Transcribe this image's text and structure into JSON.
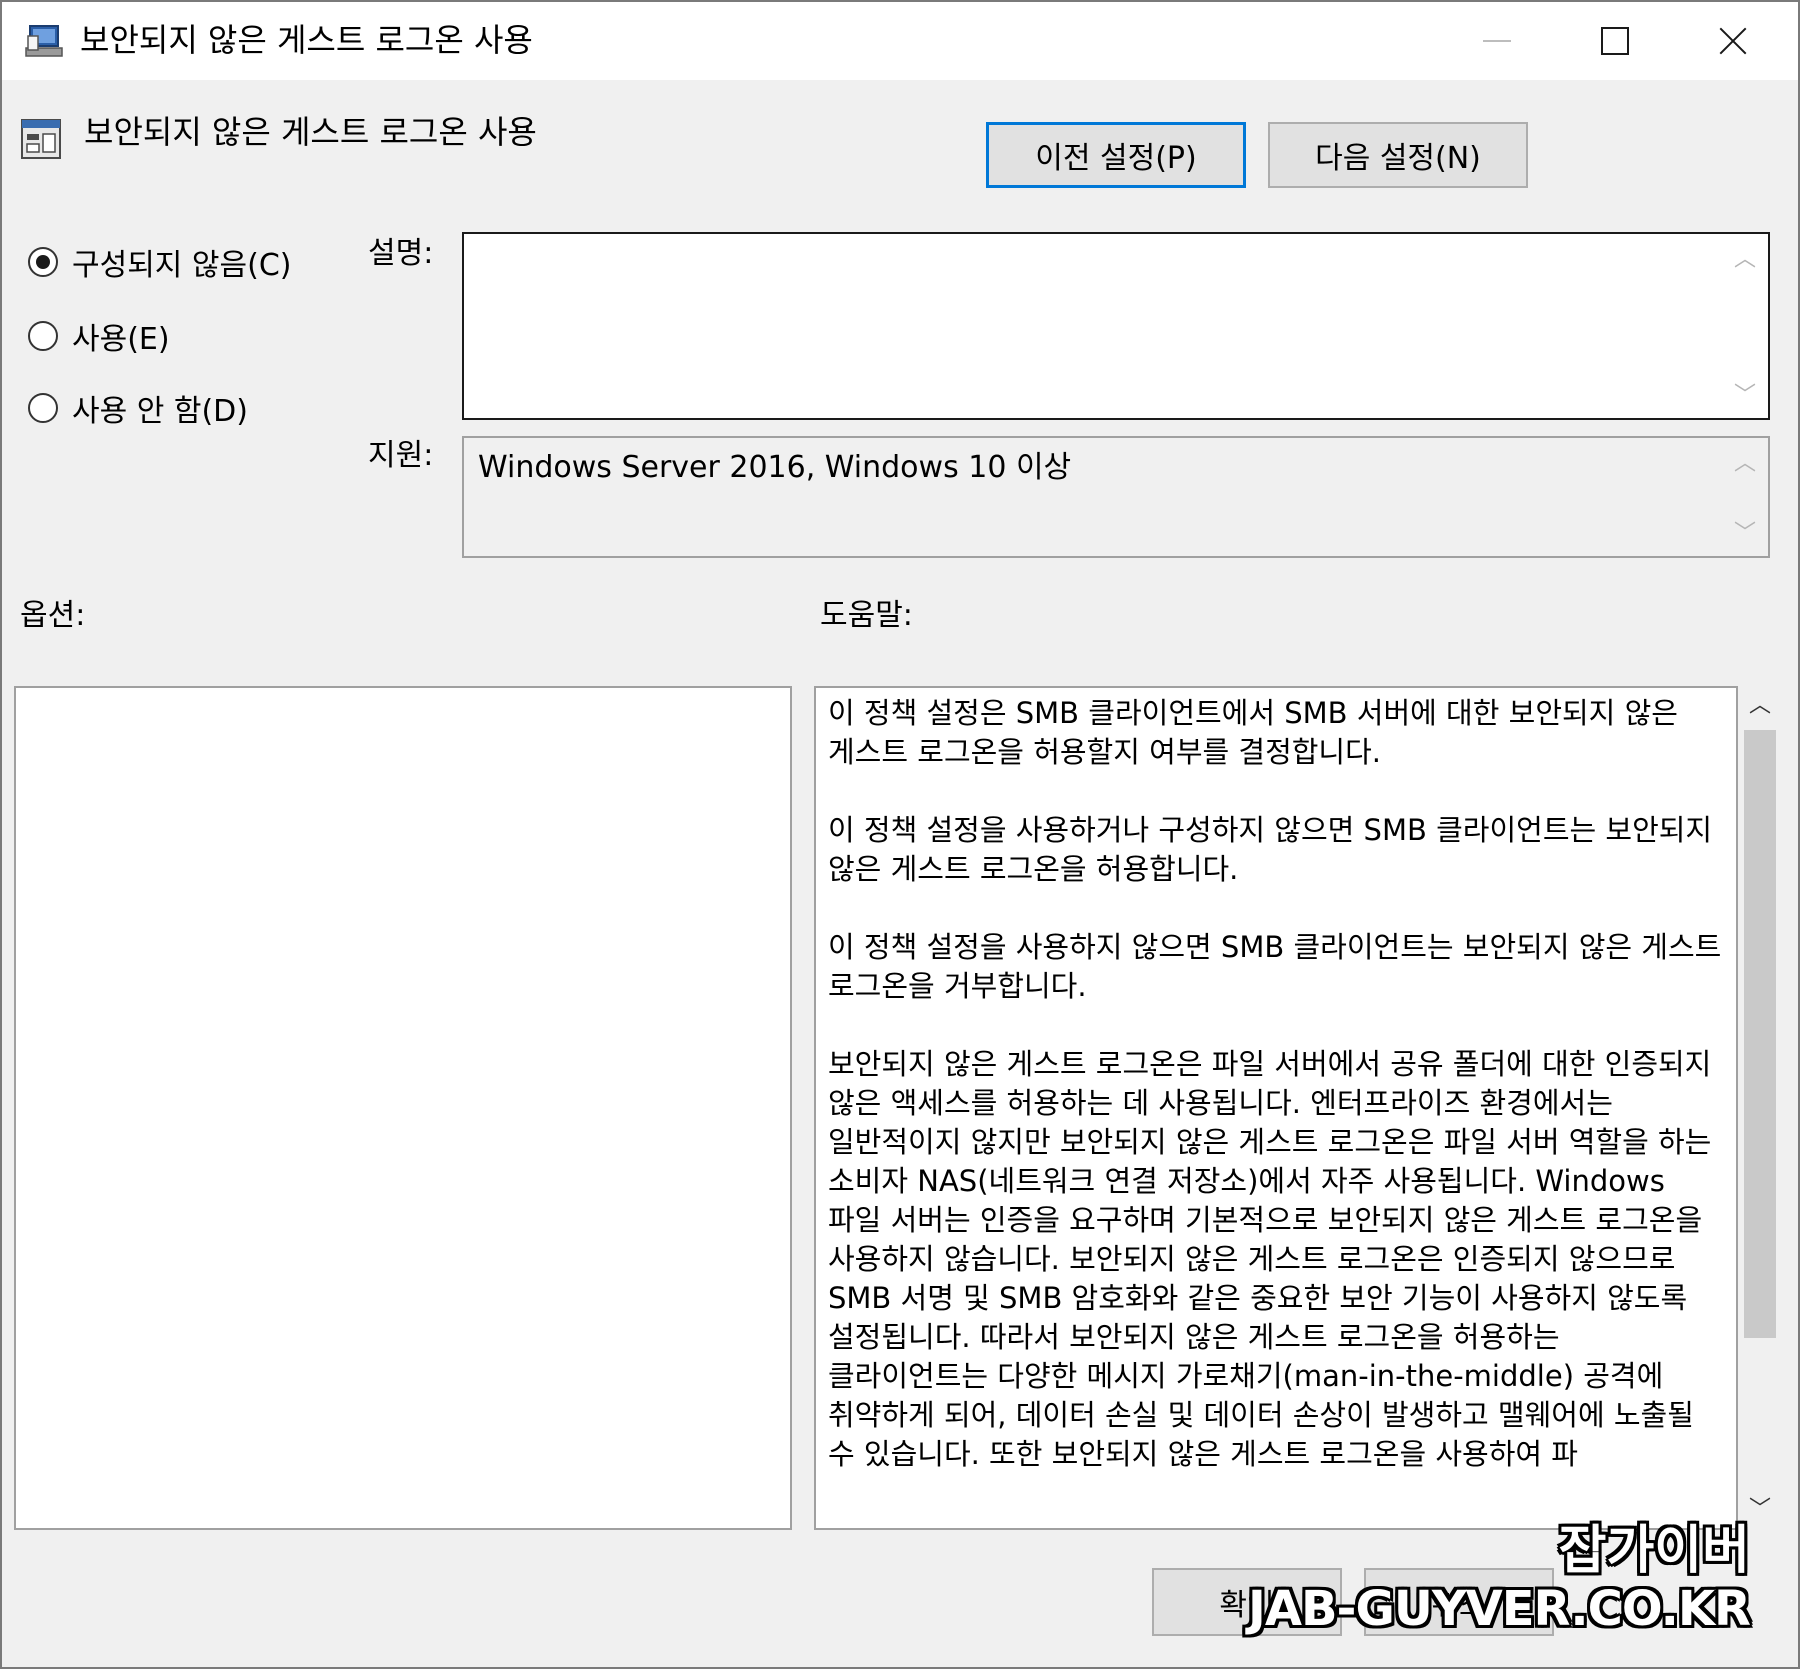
{
  "window": {
    "title": "보안되지 않은 게스트 로그온 사용",
    "app_icon": "group-policy-computer-icon",
    "controls": {
      "minimize": "minimize-icon",
      "maximize": "maximize-icon",
      "close": "close-icon"
    }
  },
  "header": {
    "policy_title": "보안되지 않은 게스트 로그온 사용",
    "policy_icon": "policy-setting-icon",
    "prev_button": "이전 설정(P)",
    "next_button": "다음 설정(N)"
  },
  "state": {
    "options": [
      {
        "label": "구성되지 않음(C)",
        "checked": true
      },
      {
        "label": "사용(E)",
        "checked": false
      },
      {
        "label": "사용 안 함(D)",
        "checked": false
      }
    ]
  },
  "fields": {
    "description_label": "설명:",
    "description_value": "",
    "supported_label": "지원:",
    "supported_value": "Windows Server 2016, Windows 10 이상"
  },
  "sections": {
    "options_label": "옵션:",
    "help_label": "도움말:"
  },
  "help_text": "이 정책 설정은 SMB 클라이언트에서 SMB 서버에 대한 보안되지 않은 게스트 로그온을 허용할지 여부를 결정합니다.\n\n이 정책 설정을 사용하거나 구성하지 않으면 SMB 클라이언트는 보안되지 않은 게스트 로그온을 허용합니다.\n\n이 정책 설정을 사용하지 않으면 SMB 클라이언트는 보안되지 않은 게스트 로그온을 거부합니다.\n\n보안되지 않은 게스트 로그온은 파일 서버에서 공유 폴더에 대한 인증되지 않은 액세스를 허용하는 데 사용됩니다. 엔터프라이즈 환경에서는 일반적이지 않지만 보안되지 않은 게스트 로그온은 파일 서버 역할을 하는 소비자 NAS(네트워크 연결 저장소)에서 자주 사용됩니다. Windows 파일 서버는 인증을 요구하며 기본적으로 보안되지 않은 게스트 로그온을 사용하지 않습니다. 보안되지 않은 게스트 로그온은 인증되지 않으므로 SMB 서명 및 SMB 암호화와 같은 중요한 보안 기능이 사용하지 않도록 설정됩니다. 따라서 보안되지 않은 게스트 로그온을 허용하는 클라이언트는 다양한 메시지 가로채기(man-in-the-middle) 공격에 취약하게 되어, 데이터 손실 및 데이터 손상이 발생하고 맬웨어에 노출될 수 있습니다. 또한 보안되지 않은 게스트 로그온을 사용하여 파",
  "footer": {
    "ok_button": "확인",
    "cancel_button": "취소"
  },
  "watermark": {
    "line1": "잡가이버",
    "line2": "JAB-GUYVER.CO.KR"
  },
  "colors": {
    "focus_border": "#0078d7",
    "dialog_bg": "#f0f0f0"
  }
}
